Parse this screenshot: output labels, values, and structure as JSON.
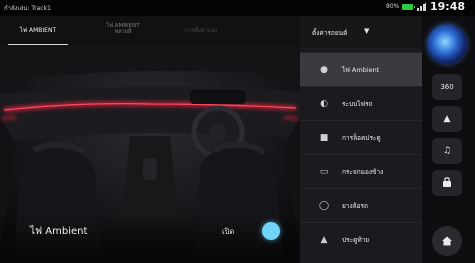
{
  "status_bar": {
    "now_playing": "กำลังเล่น: Track1",
    "battery": "80%",
    "clock": "19:48"
  },
  "tabs": [
    {
      "label": "ไฟ AMBIENT",
      "active": true
    },
    {
      "label": "ไฟ AMBIENT\nหลายสี",
      "active": false
    },
    {
      "label": "การตั้งค่าแสง",
      "active": false
    }
  ],
  "ambient_toggle": {
    "label": "ไฟ Ambient",
    "state": "เปิด",
    "on": true
  },
  "menu": {
    "header": "ตั้งค่ารถยนต์",
    "items": [
      {
        "label": "ไฟ Ambient",
        "icon": "ambient-light-icon",
        "active": true
      },
      {
        "label": "ระบบไฟรถ",
        "icon": "headlight-icon",
        "active": false
      },
      {
        "label": "การล็อคประตู",
        "icon": "lock-icon",
        "active": false
      },
      {
        "label": "กระจกมองข้าง",
        "icon": "side-mirror-icon",
        "active": false
      },
      {
        "label": "ยางล้อรถ",
        "icon": "tire-icon",
        "active": false
      },
      {
        "label": "ประตูท้าย",
        "icon": "tailgate-icon",
        "active": false
      }
    ]
  },
  "dock": {
    "buttons": [
      {
        "label": "360",
        "icon": "camera-360-icon"
      },
      {
        "label": "▲",
        "icon": "navigation-icon"
      },
      {
        "label": "♫",
        "icon": "music-icon"
      },
      {
        "label": "",
        "icon": "car-icon"
      },
      {
        "label": "",
        "icon": "home-icon"
      }
    ]
  },
  "colors": {
    "ambient_glow": "#e0203a",
    "toggle_on": "#6fd3f7",
    "active_menu_bg": "#3a3a40"
  }
}
